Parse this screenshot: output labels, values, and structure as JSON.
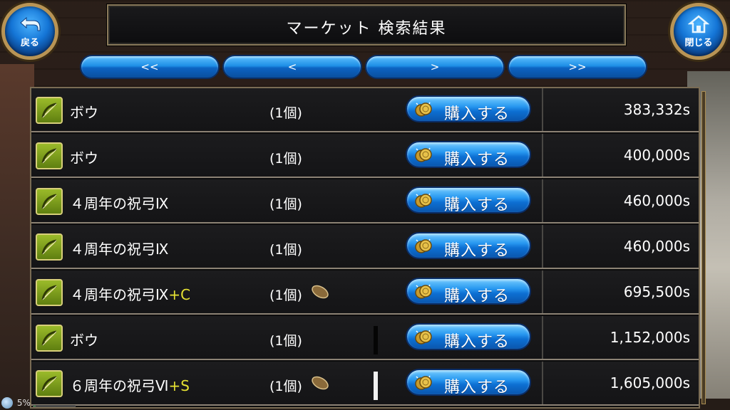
{
  "header": {
    "title": "マーケット 検索結果",
    "back_label": "戻る",
    "close_label": "閉じる"
  },
  "pager": {
    "first": "<<",
    "prev": "<",
    "next": ">",
    "last": ">>"
  },
  "buy_label": "購入する",
  "items": [
    {
      "name": "ボウ",
      "suffix": "",
      "qty": "(1個)",
      "seed": false,
      "mark": "",
      "price": "383,332s"
    },
    {
      "name": "ボウ",
      "suffix": "",
      "qty": "(1個)",
      "seed": false,
      "mark": "",
      "price": "400,000s"
    },
    {
      "name": "４周年の祝弓Ⅸ",
      "suffix": "",
      "qty": "(1個)",
      "seed": false,
      "mark": "",
      "price": "460,000s"
    },
    {
      "name": "４周年の祝弓Ⅸ",
      "suffix": "",
      "qty": "(1個)",
      "seed": false,
      "mark": "",
      "price": "460,000s"
    },
    {
      "name": "４周年の祝弓Ⅸ",
      "suffix": "+C",
      "qty": "(1個)",
      "seed": true,
      "mark": "",
      "price": "695,500s"
    },
    {
      "name": "ボウ",
      "suffix": "",
      "qty": "(1個)",
      "seed": false,
      "mark": "dark",
      "price": "1,152,000s"
    },
    {
      "name": "６周年の祝弓Ⅵ",
      "suffix": "+S",
      "qty": "(1個)",
      "seed": true,
      "mark": "white",
      "price": "1,605,000s"
    }
  ],
  "status": {
    "battery_percent": "5%",
    "battery_level": 0.05
  },
  "colors": {
    "button_blue": "#1e8fe6",
    "suffix_yellow": "#e6e233",
    "frame_gold": "#b89455"
  }
}
